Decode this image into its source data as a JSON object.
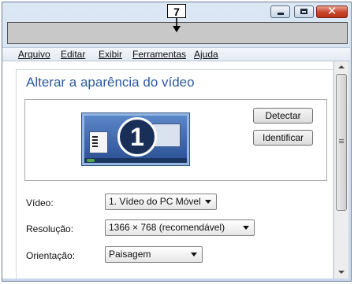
{
  "callout": {
    "number": "7"
  },
  "window_controls": {
    "close_glyph": "✕"
  },
  "menu": {
    "items": [
      "Arquivo",
      "Editar",
      "Exibir",
      "Ferramentas",
      "Ajuda"
    ]
  },
  "page": {
    "title": "Alterar a aparência do vídeo"
  },
  "display_preview": {
    "monitor_number": "1",
    "detect_button": "Detectar",
    "identify_button": "Identificar"
  },
  "settings": {
    "video_label": "Vídeo:",
    "video_value": "1. Vídeo do PC Móvel",
    "resolution_label": "Resolução:",
    "resolution_value": "1366 × 768 (recomendável)",
    "orientation_label": "Orientação:",
    "orientation_value": "Paisagem"
  },
  "colors": {
    "title_text": "#2c5ba5",
    "close_button": "#c8432a",
    "monitor_screen": "#2a4f93"
  }
}
